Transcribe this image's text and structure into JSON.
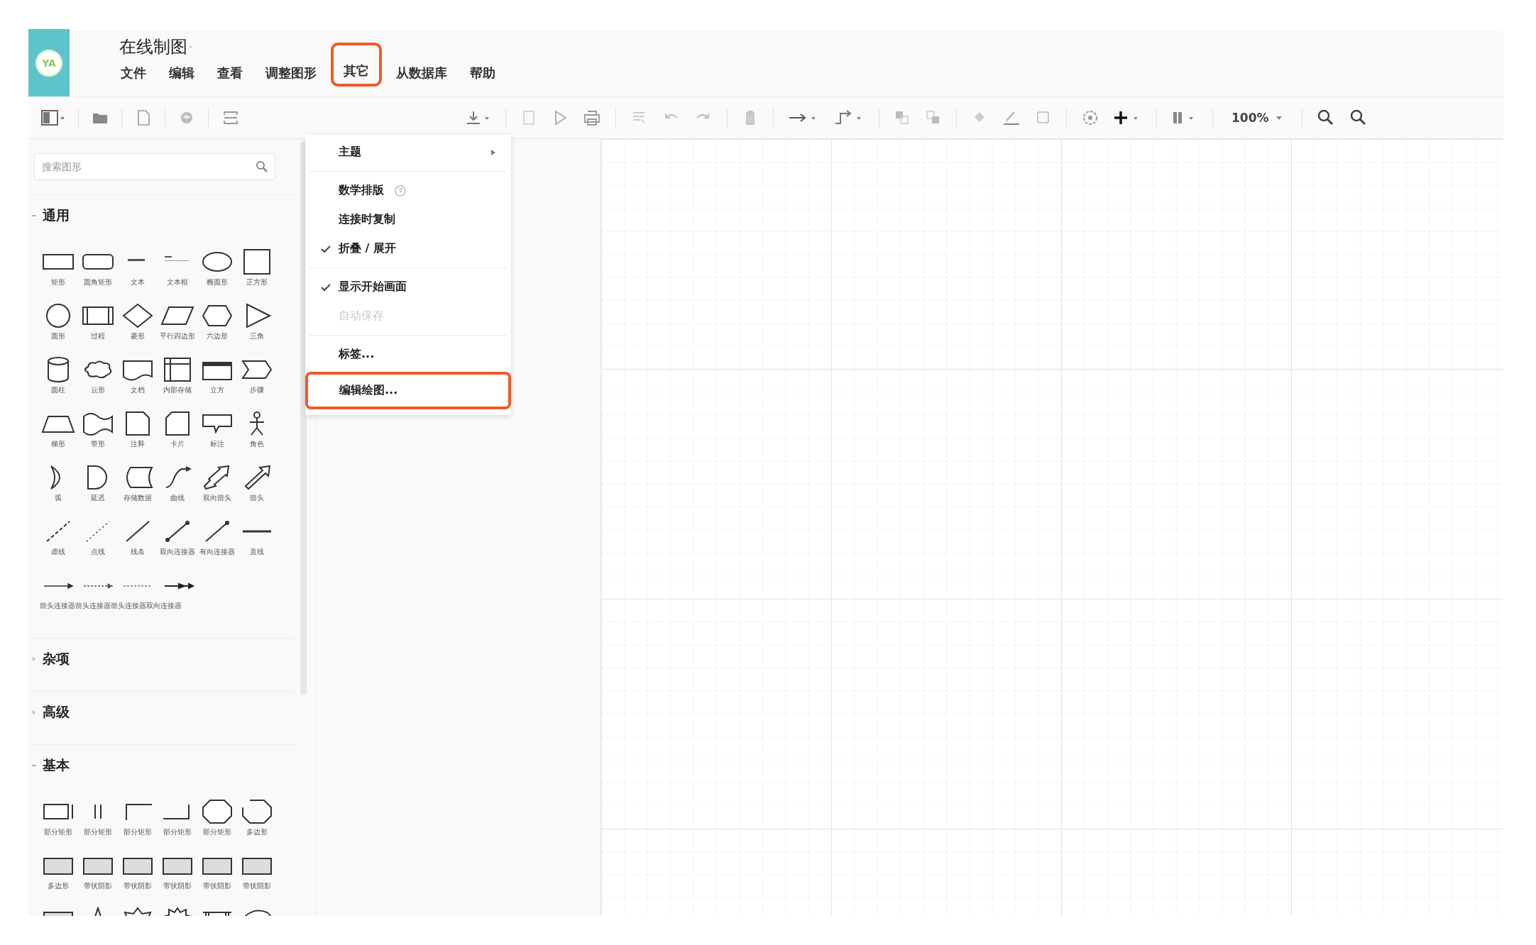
{
  "app": {
    "logo": "YA",
    "title": "在线制图",
    "title_mark": "·"
  },
  "menu_bar": [
    {
      "label": "文件",
      "highlighted": false
    },
    {
      "label": "编辑",
      "highlighted": false
    },
    {
      "label": "查看",
      "highlighted": false
    },
    {
      "label": "调整图形",
      "highlighted": false
    },
    {
      "label": "其它",
      "highlighted": true
    },
    {
      "label": "从数据库",
      "highlighted": false
    },
    {
      "label": "帮助",
      "highlighted": false
    }
  ],
  "toolbar": {
    "zoom": "100%"
  },
  "dropdown": {
    "groups": [
      [
        {
          "label": "主题",
          "kind": "submenu",
          "checked": false,
          "disabled": false,
          "highlighted": false
        }
      ],
      [
        {
          "label": "数学排版",
          "kind": "help",
          "checked": false,
          "disabled": false,
          "highlighted": false
        },
        {
          "label": "连接时复制",
          "kind": "item",
          "checked": false,
          "disabled": false,
          "highlighted": false
        },
        {
          "label": "折叠 / 展开",
          "kind": "item",
          "checked": true,
          "disabled": false,
          "highlighted": false
        }
      ],
      [
        {
          "label": "显示开始画面",
          "kind": "item",
          "checked": true,
          "disabled": false,
          "highlighted": false
        },
        {
          "label": "自动保存",
          "kind": "item",
          "checked": false,
          "disabled": true,
          "highlighted": false
        }
      ],
      [
        {
          "label": "标签...",
          "kind": "item",
          "checked": false,
          "disabled": false,
          "highlighted": false
        },
        {
          "label": "编辑绘图...",
          "kind": "item",
          "checked": false,
          "disabled": false,
          "highlighted": true
        }
      ]
    ]
  },
  "sidebar": {
    "search": {
      "placeholder": "搜索图形"
    },
    "sections": [
      {
        "title": "通用",
        "expanded": true,
        "shapes": [
          {
            "kind": "shape",
            "label": "矩形"
          },
          {
            "kind": "shape",
            "label": "圆角矩形"
          },
          {
            "kind": "shape",
            "label": "文本"
          },
          {
            "kind": "shape",
            "label": "文本框"
          },
          {
            "kind": "shape",
            "label": "椭圆形"
          },
          {
            "kind": "shape",
            "label": "正方形"
          },
          {
            "kind": "shape",
            "label": "圆形"
          },
          {
            "kind": "shape",
            "label": "过程"
          },
          {
            "kind": "shape",
            "label": "菱形"
          },
          {
            "kind": "shape",
            "label": "平行四边形"
          },
          {
            "kind": "shape",
            "label": "六边形"
          },
          {
            "kind": "shape",
            "label": "三角"
          },
          {
            "kind": "shape",
            "label": "圆柱"
          },
          {
            "kind": "shape",
            "label": "云形"
          },
          {
            "kind": "shape",
            "label": "文档"
          },
          {
            "kind": "shape",
            "label": "内部存储"
          },
          {
            "kind": "shape",
            "label": "立方"
          },
          {
            "kind": "shape",
            "label": "步骤"
          },
          {
            "kind": "shape",
            "label": "梯形"
          },
          {
            "kind": "shape",
            "label": "带形"
          },
          {
            "kind": "shape",
            "label": "注释"
          },
          {
            "kind": "shape",
            "label": "卡片"
          },
          {
            "kind": "shape",
            "label": "标注"
          },
          {
            "kind": "shape",
            "label": "角色"
          },
          {
            "kind": "shape",
            "label": "弧"
          },
          {
            "kind": "shape",
            "label": "延迟"
          },
          {
            "kind": "shape",
            "label": "存储数据"
          },
          {
            "kind": "shape",
            "label": "曲线"
          },
          {
            "kind": "shape",
            "label": "双向箭头"
          },
          {
            "kind": "shape",
            "label": "箭头"
          },
          {
            "kind": "shape",
            "label": "虚线"
          },
          {
            "kind": "shape",
            "label": "点线"
          },
          {
            "kind": "shape",
            "label": "线条"
          },
          {
            "kind": "shape",
            "label": "双向连接器"
          },
          {
            "kind": "shape",
            "label": "有向连接器"
          },
          {
            "kind": "shape",
            "label": "直线"
          }
        ],
        "connectors": {
          "label": "箭头连接器箭头连接器箭头连接器双向连接器"
        }
      },
      {
        "title": "杂项",
        "expanded": false
      },
      {
        "title": "高级",
        "expanded": false
      },
      {
        "title": "基本",
        "expanded": true,
        "shapes": [
          {
            "kind": "shape",
            "label": "部分矩形"
          },
          {
            "kind": "shape",
            "label": "部分矩形"
          },
          {
            "kind": "shape",
            "label": "部分矩形"
          },
          {
            "kind": "shape",
            "label": "部分矩形"
          },
          {
            "kind": "shape",
            "label": "部分矩形"
          },
          {
            "kind": "shape",
            "label": "多边形"
          },
          {
            "kind": "shape",
            "label": "多边形"
          },
          {
            "kind": "shape",
            "label": "带状阴影"
          },
          {
            "kind": "shape",
            "label": "带状阴影"
          },
          {
            "kind": "shape",
            "label": "带状阴影"
          },
          {
            "kind": "shape",
            "label": "带状阴影"
          },
          {
            "kind": "shape",
            "label": "带状阴影"
          },
          {
            "kind": "shape"
          },
          {
            "kind": "shape"
          },
          {
            "kind": "shape"
          },
          {
            "kind": "shape"
          },
          {
            "kind": "shape"
          },
          {
            "kind": "shape"
          }
        ]
      }
    ]
  }
}
